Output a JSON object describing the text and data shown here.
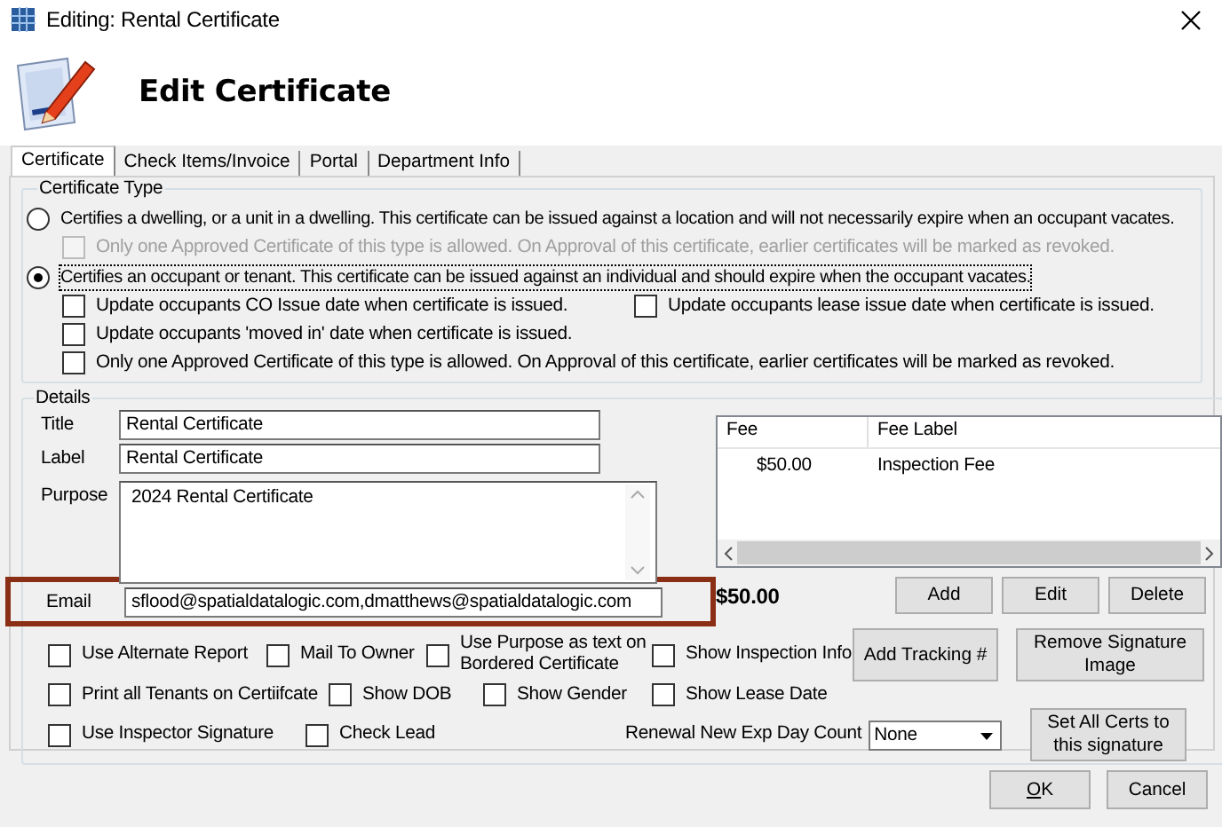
{
  "window": {
    "title": "Editing: Rental Certificate"
  },
  "header": {
    "title": "Edit Certificate"
  },
  "tabs": [
    {
      "label": "Certificate",
      "selected": true
    },
    {
      "label": "Check Items/Invoice",
      "selected": false
    },
    {
      "label": "Portal",
      "selected": false
    },
    {
      "label": "Department Info",
      "selected": false
    }
  ],
  "certificate_type": {
    "legend": "Certificate Type",
    "options": [
      {
        "label": "Certifies a dwelling, or a unit in a dwelling. This certificate can be issued against a location and will not necessarily expire when an occupant vacates.",
        "selected": false,
        "sub_options": [
          {
            "label": "Only one Approved Certificate of this type is allowed.  On Approval of this certificate, earlier certificates will be marked as revoked.",
            "checked": false,
            "disabled": true,
            "wide": true
          }
        ]
      },
      {
        "label": "Certifies an occupant or tenant. This certificate can be issued against an individual and should expire when the occupant vacates.",
        "selected": true,
        "sub_options": [
          {
            "label": "Update occupants CO Issue date when certificate is issued.",
            "checked": false,
            "disabled": false,
            "wide": false
          },
          {
            "label": "Update occupants lease issue date when certificate is issued.",
            "checked": false,
            "disabled": false,
            "wide": false
          },
          {
            "label": "Update occupants 'moved in' date when certificate is issued.",
            "checked": false,
            "disabled": false,
            "wide": true
          },
          {
            "label": "Only one Approved Certificate of this type is allowed.  On Approval of this certificate, earlier certificates will be marked as revoked.",
            "checked": false,
            "disabled": false,
            "wide": true
          }
        ]
      }
    ]
  },
  "details": {
    "legend": "Details",
    "fields": [
      {
        "kind": "text",
        "label": "Title",
        "value": "Rental Certificate",
        "highlighted": false
      },
      {
        "kind": "text",
        "label": "Label",
        "value": "Rental Certificate",
        "highlighted": false
      },
      {
        "kind": "textarea",
        "label": "Purpose",
        "value": "2024 Rental Certificate",
        "highlighted": false
      },
      {
        "kind": "text",
        "label": "Email",
        "value": "sflood@spatialdatalogic.com,dmatthews@spatialdatalogic.com",
        "highlighted": true
      }
    ],
    "fees": {
      "columns": [
        "Fee",
        "Fee Label"
      ],
      "rows": [
        [
          "$50.00",
          "Inspection Fee"
        ]
      ],
      "total": "$50.00",
      "buttons": [
        "Add",
        "Edit",
        "Delete"
      ]
    },
    "option_rows": [
      [
        {
          "kind": "checkbox",
          "label": "Use Alternate Report",
          "checked": false
        },
        {
          "kind": "checkbox",
          "label": "Mail To Owner",
          "checked": false
        },
        {
          "kind": "checkbox",
          "label": "Use Purpose as text on Bordered Certificate",
          "checked": false
        },
        {
          "kind": "checkbox",
          "label": "Show Inspection Info",
          "checked": false
        },
        {
          "kind": "button",
          "label": "Add Tracking #"
        },
        {
          "kind": "button",
          "label": "Remove Signature Image"
        }
      ],
      [
        {
          "kind": "checkbox",
          "label": "Print all Tenants on Certiifcate",
          "checked": false
        },
        {
          "kind": "checkbox",
          "label": "Show DOB",
          "checked": false
        },
        {
          "kind": "checkbox",
          "label": "Show Gender",
          "checked": false
        },
        {
          "kind": "checkbox",
          "label": "Show Lease Date",
          "checked": false
        }
      ],
      [
        {
          "kind": "checkbox",
          "label": "Use Inspector Signature",
          "checked": false
        },
        {
          "kind": "checkbox",
          "label": "Check Lead",
          "checked": false
        },
        {
          "kind": "dropdown",
          "label": "Renewal New Exp Day Count",
          "value": "None"
        },
        {
          "kind": "button",
          "label": "Set All Certs to this signature"
        }
      ]
    ]
  },
  "footer_buttons": [
    {
      "label": "OK",
      "mnemonic": true
    },
    {
      "label": "Cancel",
      "mnemonic": false
    }
  ]
}
